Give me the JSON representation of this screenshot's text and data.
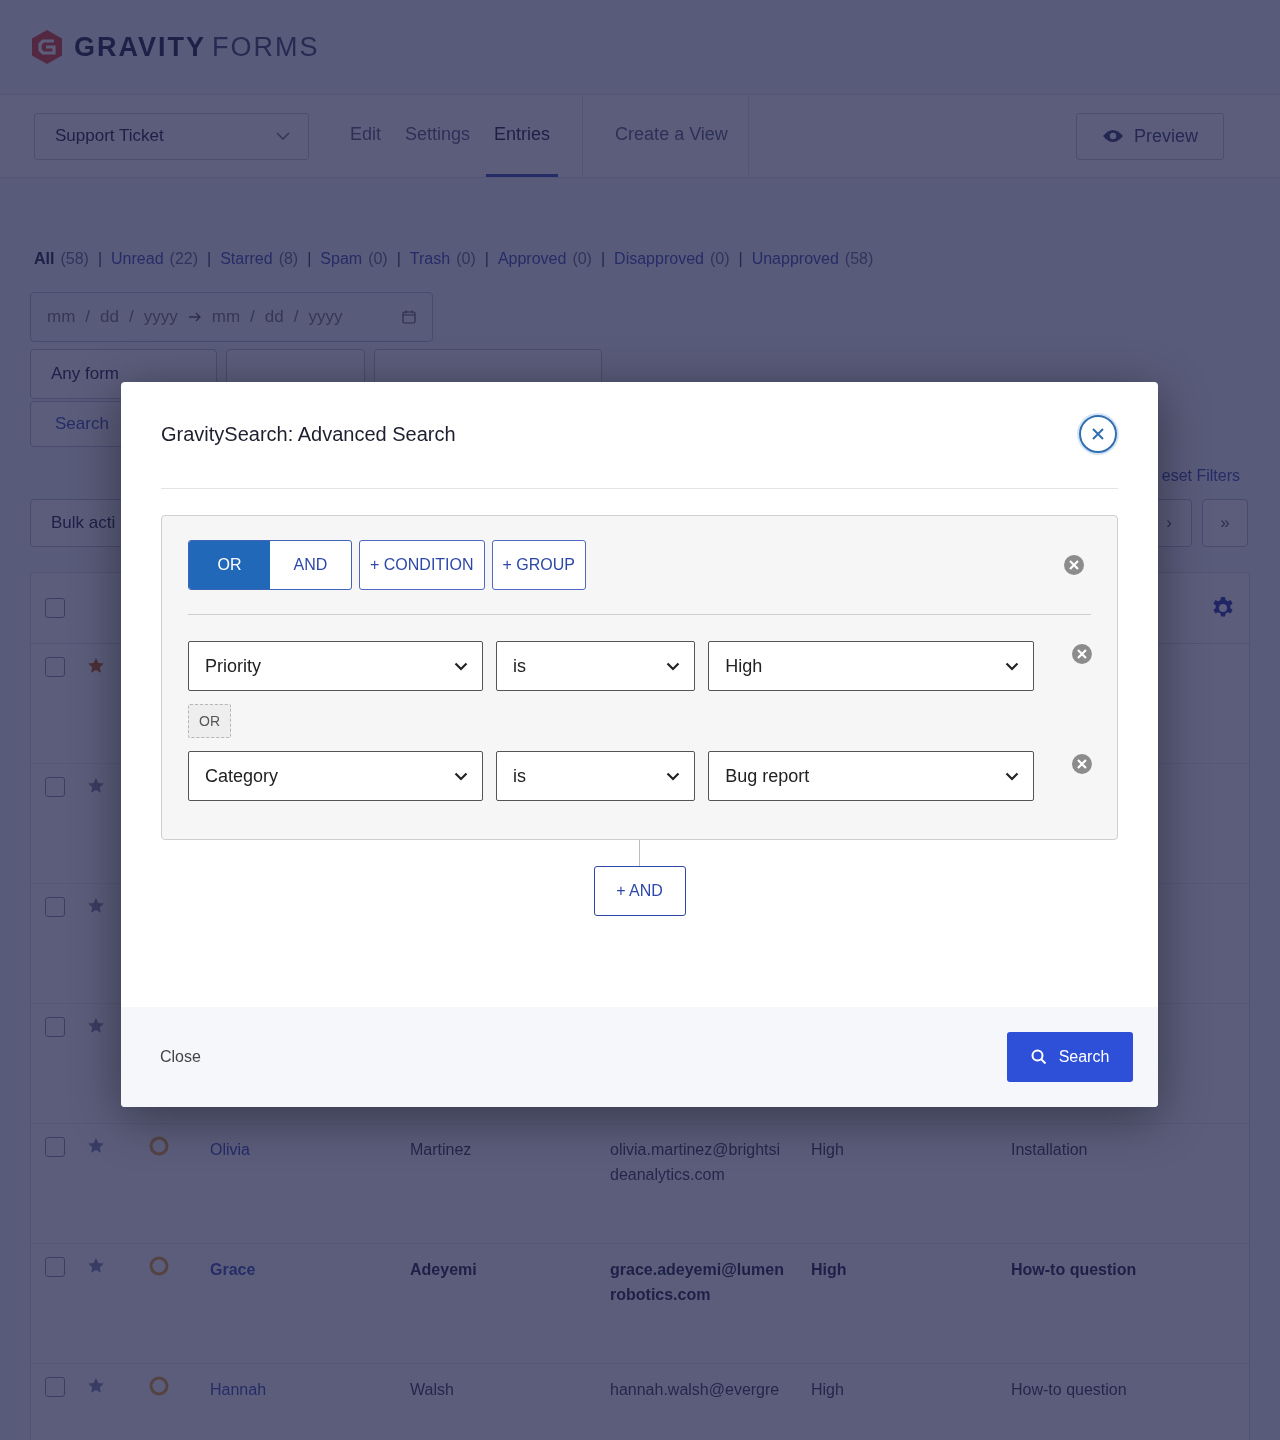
{
  "header": {
    "logo": {
      "word1": "GRAVITY",
      "word2": "FORMS"
    }
  },
  "toolbar": {
    "form_select": "Support Ticket",
    "tabs": [
      {
        "label": "Edit",
        "selected": false
      },
      {
        "label": "Settings",
        "selected": false
      },
      {
        "label": "Entries",
        "selected": true
      }
    ],
    "extra_tab": "Create a View",
    "preview_button": "Preview"
  },
  "filter_separator": "|",
  "filter_links": [
    {
      "label": "All",
      "count": "(58)",
      "selected": true
    },
    {
      "label": "Unread",
      "count": "(22)",
      "selected": false
    },
    {
      "label": "Starred",
      "count": "(8)",
      "selected": false
    },
    {
      "label": "Spam",
      "count": "(0)",
      "selected": false
    },
    {
      "label": "Trash",
      "count": "(0)",
      "selected": false
    },
    {
      "label": "Approved",
      "count": "(0)",
      "selected": false
    },
    {
      "label": "Disapproved",
      "count": "(0)",
      "selected": false
    },
    {
      "label": "Unapproved",
      "count": "(58)",
      "selected": false
    }
  ],
  "date_range": {
    "separator": "/",
    "from": [
      "mm",
      "dd",
      "yyyy"
    ],
    "to": [
      "mm",
      "dd",
      "yyyy"
    ]
  },
  "field_filter": {
    "field": "Any form",
    "search_button": "Search",
    "reset_link": "eset Filters"
  },
  "bulk_actions": "Bulk acti",
  "pagination": [
    "›",
    "»"
  ],
  "table": {
    "select_all_checked": false,
    "rows": [
      {
        "checked": false,
        "starred": true
      },
      {
        "checked": false,
        "starred": false
      },
      {
        "checked": false,
        "starred": false
      },
      {
        "checked": false,
        "starred": false
      },
      {
        "checked": false,
        "starred": false,
        "unread": false,
        "first": "Olivia",
        "last": "Martinez",
        "email": "olivia.martinez@brightsideanalytics.com",
        "priority": "High",
        "category": "Installation"
      },
      {
        "checked": false,
        "starred": false,
        "unread": true,
        "first": "Grace",
        "last": "Adeyemi",
        "email": "grace.adeyemi@lumenrobotics.com",
        "priority": "High",
        "category": "How-to question"
      },
      {
        "checked": false,
        "starred": false,
        "unread": false,
        "first": "Hannah",
        "last": "Walsh",
        "email": "hannah.walsh@evergre",
        "priority": "High",
        "category": "How-to question"
      }
    ]
  },
  "modal": {
    "title": "GravitySearch: Advanced Search",
    "group": {
      "operators": [
        {
          "label": "OR",
          "selected": true
        },
        {
          "label": "AND",
          "selected": false
        }
      ],
      "add_condition": "+ CONDITION",
      "add_group": "+ GROUP",
      "conditions": [
        {
          "field": "Priority",
          "operator": "is",
          "value": "High"
        },
        {
          "field": "Category",
          "operator": "is",
          "value": "Bug report"
        }
      ],
      "joiner": "OR"
    },
    "add_and": "+ AND",
    "close": "Close",
    "search": "Search"
  }
}
